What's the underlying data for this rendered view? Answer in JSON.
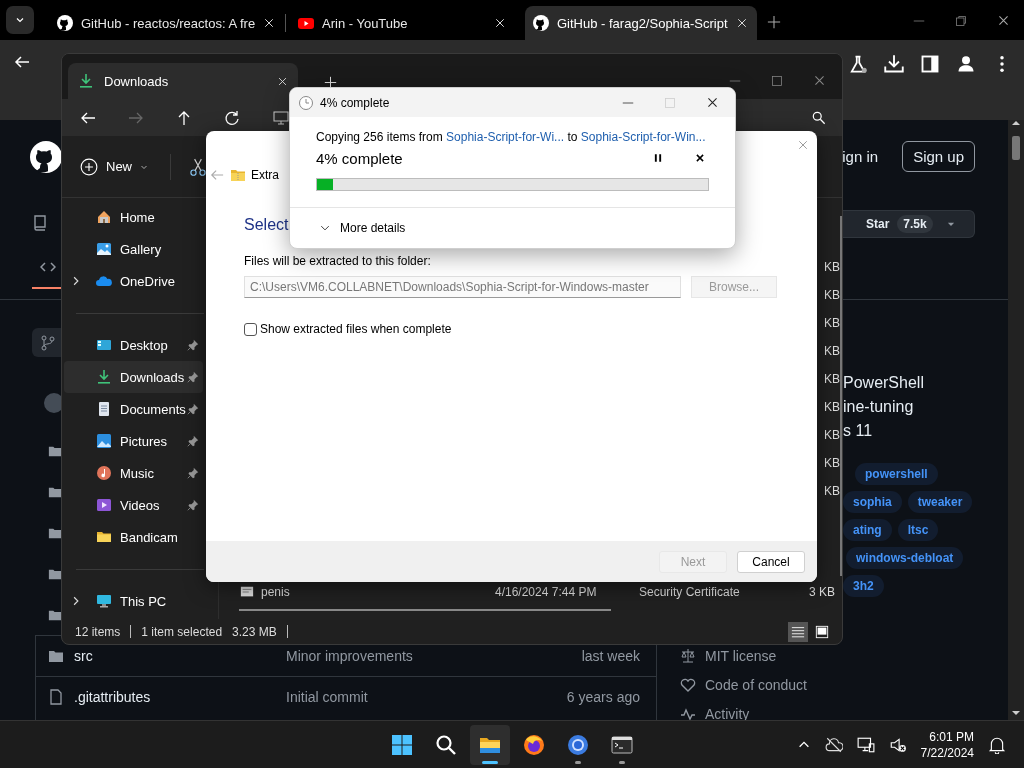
{
  "browser": {
    "tabs": [
      {
        "kind": "github",
        "title": "GitHub - reactos/reactos: A fre",
        "selected": false
      },
      {
        "kind": "youtube",
        "title": "Arin - YouTube",
        "selected": false
      },
      {
        "kind": "github",
        "title": "GitHub - farag2/Sophia-Script",
        "selected": true
      }
    ]
  },
  "github": {
    "sign_in": "ign in",
    "sign_up": "Sign up",
    "star": "Star",
    "star_count": "7.5k",
    "about_lines": [
      "PowerShell",
      "ine-tuning",
      "s 11"
    ],
    "topic_rows": [
      [
        "powershell"
      ],
      [
        "sophia",
        "tweaker"
      ],
      [
        "ating",
        "ltsc"
      ],
      [
        "windows-debloat"
      ],
      [
        "3h2"
      ]
    ],
    "files": [
      {
        "kind": "folder",
        "name": "src",
        "message": "Minor improvements",
        "time": "last week"
      },
      {
        "kind": "file",
        "name": ".gitattributes",
        "message": "Initial commit",
        "time": "6 years ago"
      }
    ],
    "links": [
      {
        "kind": "license",
        "label": "MIT license"
      },
      {
        "kind": "conduct",
        "label": "Code of conduct"
      },
      {
        "kind": "activity",
        "label": "Activity"
      }
    ]
  },
  "explorer": {
    "tab": "Downloads",
    "nav": [
      {
        "kind": "back",
        "disabled": false
      },
      {
        "kind": "forward",
        "disabled": true
      },
      {
        "kind": "up",
        "disabled": false
      },
      {
        "kind": "refresh",
        "disabled": false
      }
    ],
    "new_label": "New",
    "sidebar": [
      [
        {
          "kind": "home",
          "label": "Home",
          "pinned": false,
          "selected": false,
          "expandable": false
        },
        {
          "kind": "gallery",
          "label": "Gallery",
          "pinned": false,
          "selected": false,
          "expandable": false
        },
        {
          "kind": "onedrive",
          "label": "OneDrive",
          "pinned": false,
          "selected": false,
          "expandable": true
        }
      ],
      [
        {
          "kind": "desktop",
          "label": "Desktop",
          "pinned": true,
          "selected": false,
          "expandable": false
        },
        {
          "kind": "downloads",
          "label": "Downloads",
          "pinned": true,
          "selected": true,
          "expandable": false
        },
        {
          "kind": "documents",
          "label": "Documents",
          "pinned": true,
          "selected": false,
          "expandable": false
        },
        {
          "kind": "pictures",
          "label": "Pictures",
          "pinned": true,
          "selected": false,
          "expandable": false
        },
        {
          "kind": "music",
          "label": "Music",
          "pinned": true,
          "selected": false,
          "expandable": false
        },
        {
          "kind": "videos",
          "label": "Videos",
          "pinned": true,
          "selected": false,
          "expandable": false
        },
        {
          "kind": "folder",
          "label": "Bandicam",
          "pinned": false,
          "selected": false,
          "expandable": false
        }
      ],
      [
        {
          "kind": "pc",
          "label": "This PC",
          "pinned": false,
          "selected": false,
          "expandable": true
        }
      ]
    ],
    "files": [
      {
        "size": "KB"
      },
      {
        "size": "KB"
      },
      {
        "size": "KB"
      },
      {
        "size": "KB"
      },
      {
        "size": "KB"
      },
      {
        "size": "KB"
      },
      {
        "size": "KB"
      },
      {
        "size": "KB"
      },
      {
        "size": "KB"
      },
      {
        "name": "penis",
        "date": "4/16/2024 7:44 PM",
        "type": "Security Certificate",
        "size": "3 KB"
      }
    ],
    "status": {
      "count": "12 items",
      "selection": "1 item selected",
      "size": "3.23 MB"
    },
    "views": [
      {
        "kind": "details",
        "selected": true
      },
      {
        "kind": "tiles",
        "selected": false
      }
    ]
  },
  "extract": {
    "title": "Extra",
    "heading": "Select",
    "folder_label": "Files will be extracted to this folder:",
    "path": "C:\\Users\\VM6.COLLABNET\\Downloads\\Sophia-Script-for-Windows-master",
    "browse": {
      "label": "Browse...",
      "disabled": true
    },
    "show_files": {
      "label": "Show extracted files when complete",
      "checked": false
    },
    "buttons": [
      {
        "label": "Next",
        "disabled": true
      },
      {
        "label": "Cancel",
        "disabled": false
      }
    ]
  },
  "copy": {
    "title": "4% complete",
    "prefix": "Copying 256 items from",
    "source": "Sophia-Script-for-Wi...",
    "joiner": "to",
    "target": "Sophia-Script-for-Win...",
    "percent": "4% complete",
    "level": 0.04,
    "more": "More details"
  },
  "taskbar": {
    "apps": [
      {
        "kind": "start",
        "running": false,
        "selected": false
      },
      {
        "kind": "search",
        "running": false,
        "selected": false
      },
      {
        "kind": "explorer",
        "running": true,
        "selected": true
      },
      {
        "kind": "firefox",
        "running": false,
        "selected": false
      },
      {
        "kind": "chrome",
        "running": true,
        "selected": false
      },
      {
        "kind": "terminal",
        "running": true,
        "selected": false
      }
    ],
    "time": "6:01 PM",
    "date": "7/22/2024"
  }
}
